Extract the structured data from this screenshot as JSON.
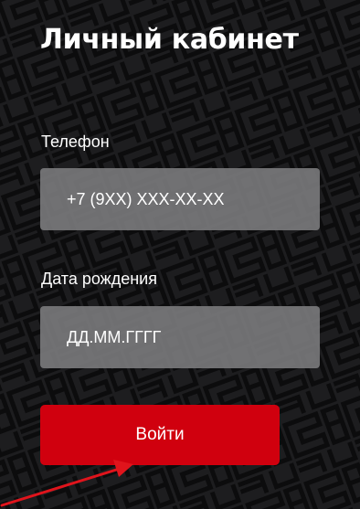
{
  "page": {
    "title": "Личный кабинет"
  },
  "form": {
    "phone": {
      "label": "Телефон",
      "placeholder": "+7 (9XX) XXX-XX-XX",
      "value": ""
    },
    "birthdate": {
      "label": "Дата рождения",
      "placeholder": "ДД.ММ.ГГГГ",
      "value": ""
    },
    "submit_label": "Войти"
  },
  "colors": {
    "background": "#1d1d1f",
    "pattern_stroke": "#0c0c0d",
    "field_background": "#7d7d80",
    "button": "#d0000e",
    "annotation_arrow": "#e0141c"
  },
  "icons": {
    "background": "bar-logo-pattern",
    "annotation": "red-arrow"
  }
}
